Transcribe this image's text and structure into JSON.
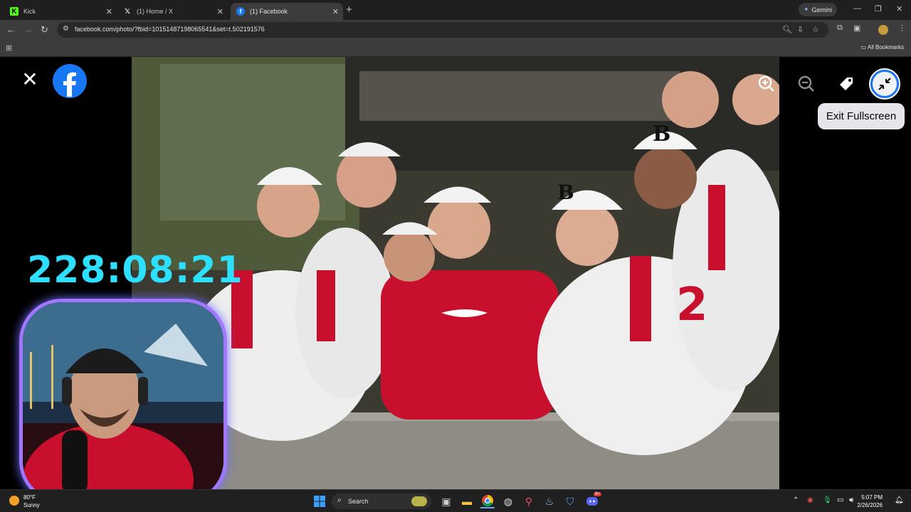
{
  "browser": {
    "tabs": [
      {
        "label": "Kick",
        "favicon": "kick-icon",
        "active": false
      },
      {
        "label": "(1) Home / X",
        "favicon": "x-icon",
        "active": false
      },
      {
        "label": "(1) Facebook",
        "favicon": "facebook-icon",
        "active": true
      }
    ],
    "gemini_label": "Gemini",
    "url": "facebook.com/photo/?fbid=10151487198065541&set=t.502191576",
    "all_bookmarks": "All Bookmarks"
  },
  "viewer": {
    "tooltip": "Exit Fullscreen",
    "controls": [
      "zoom-in-icon",
      "zoom-out-icon",
      "tag-icon",
      "exit-fullscreen-icon"
    ],
    "photo_description_colors": {
      "jersey_red": "#c8102e",
      "jersey_white": "#f2f2f2"
    }
  },
  "overlay": {
    "timer": "228:08:21",
    "webcam_border_color": "#a277ff"
  },
  "taskbar": {
    "temperature": "80°F",
    "condition": "Sunny",
    "search_label": "Search",
    "time": "5:07 PM",
    "date": "2/26/2026",
    "discord_badge": "9+"
  }
}
